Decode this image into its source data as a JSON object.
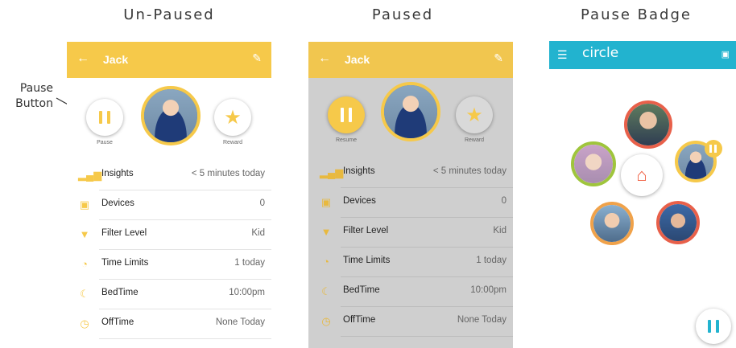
{
  "headings": {
    "unpaused": "Un-Paused",
    "paused": "Paused",
    "badge": "Pause Badge"
  },
  "annotation": {
    "line1": "Pause",
    "line2": "Button"
  },
  "profile": {
    "name": "Jack"
  },
  "buttons": {
    "pause_label": "Pause",
    "resume_label": "Resume",
    "reward_label": "Reward"
  },
  "rows": [
    {
      "icon": "insights-icon",
      "label": "Insights",
      "value": "< 5 minutes today"
    },
    {
      "icon": "devices-icon",
      "label": "Devices",
      "value": "0"
    },
    {
      "icon": "filter-icon",
      "label": "Filter Level",
      "value": "Kid"
    },
    {
      "icon": "time-limits-icon",
      "label": "Time Limits",
      "value": "1 today"
    },
    {
      "icon": "moon-icon",
      "label": "BedTime",
      "value": "10:00pm"
    },
    {
      "icon": "clock-icon",
      "label": "OffTime",
      "value": "None Today"
    }
  ],
  "circle_app": {
    "logo": "circle"
  },
  "colors": {
    "accent": "#f6c94a",
    "circle_bar": "#22b3cf",
    "home": "#f05a3c"
  }
}
